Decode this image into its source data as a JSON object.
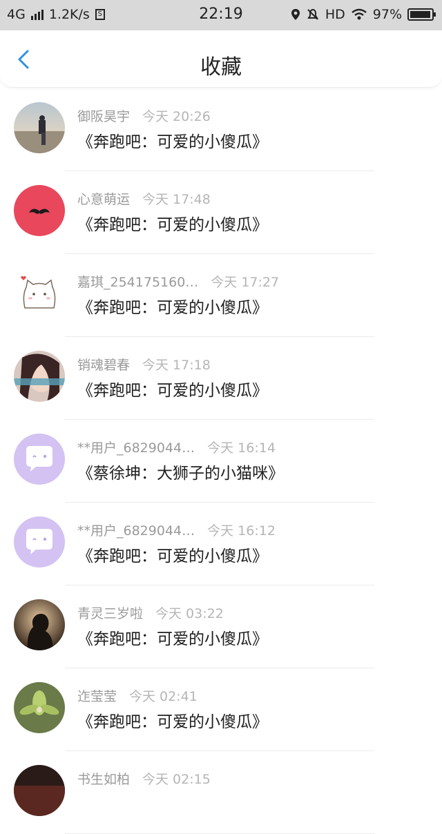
{
  "status_bar": {
    "network": "4G",
    "speed": "1.2K/s",
    "time": "22:19",
    "hd": "HD",
    "battery": "97%",
    "battery_level": 0.97
  },
  "header": {
    "title": "收藏"
  },
  "colors": {
    "back": "#2d8fe6",
    "mustache_bg": "#e8475c",
    "chat_bg": "#d3c2f2"
  },
  "items": [
    {
      "name": "御阪昊宇",
      "time": "今天 20:26",
      "content": "《奔跑吧：可爱的小傻瓜》",
      "avatar": "beach-photo"
    },
    {
      "name": "心意萌运",
      "time": "今天 17:48",
      "content": "《奔跑吧：可爱的小傻瓜》",
      "avatar": "mustache-icon"
    },
    {
      "name": "嘉琪_254175160…",
      "time": "今天 17:27",
      "content": "《奔跑吧：可爱的小傻瓜》",
      "avatar": "cat-cartoon"
    },
    {
      "name": "销魂碧春",
      "time": "今天 17:18",
      "content": "《奔跑吧：可爱的小傻瓜》",
      "avatar": "girl-photo"
    },
    {
      "name": "**用户_6829044…",
      "time": "今天 16:14",
      "content": "《蔡徐坤：大狮子的小猫咪》",
      "avatar": "chat-bubble-icon"
    },
    {
      "name": "**用户_6829044…",
      "time": "今天 16:12",
      "content": "《奔跑吧：可爱的小傻瓜》",
      "avatar": "chat-bubble-icon"
    },
    {
      "name": "青灵三岁啦",
      "time": "今天 03:22",
      "content": "《奔跑吧：可爱的小傻瓜》",
      "avatar": "silhouette-photo"
    },
    {
      "name": "迮莹莹",
      "time": "今天 02:41",
      "content": "《奔跑吧：可爱的小傻瓜》",
      "avatar": "orchid-photo"
    },
    {
      "name": "书生如柏",
      "time": "今天 02:15",
      "content": "",
      "avatar": "dark-photo"
    }
  ]
}
